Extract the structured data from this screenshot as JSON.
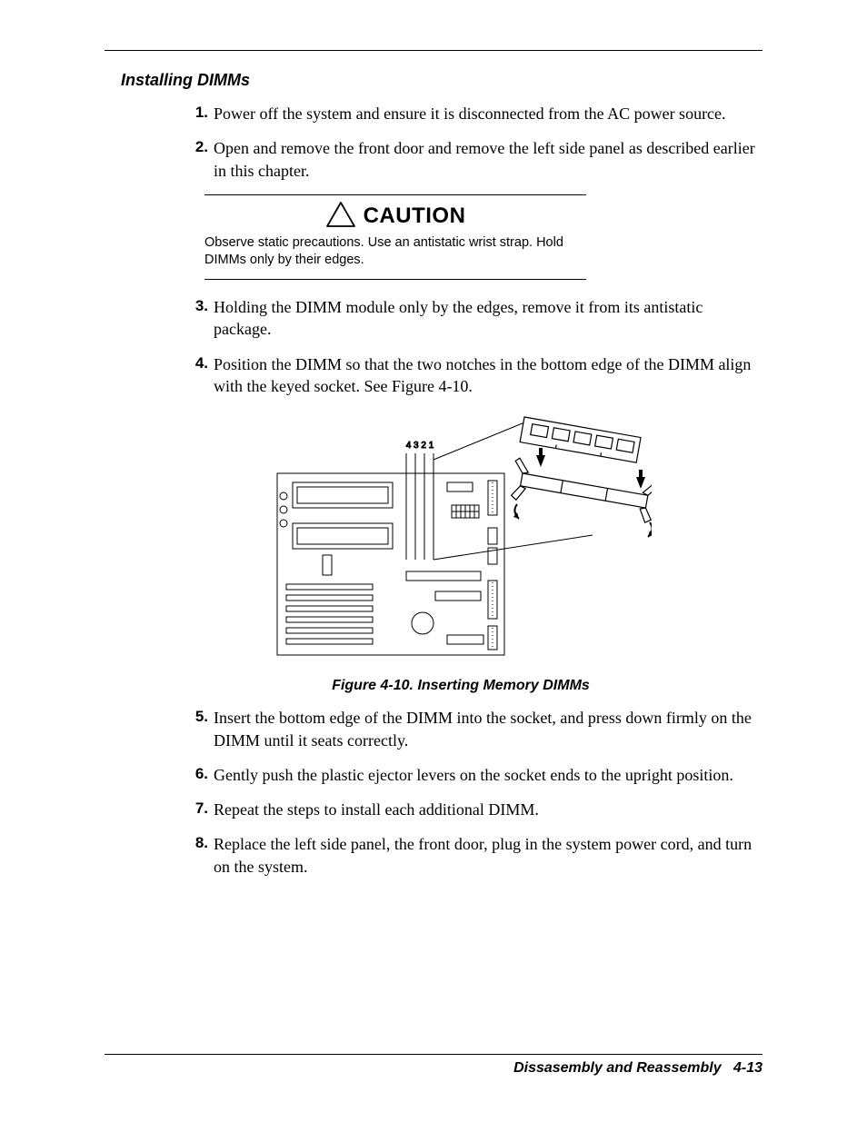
{
  "section_title": "Installing DIMMs",
  "steps": [
    "Power off the system and ensure it is disconnected from the AC power source.",
    "Open and remove the front door and remove the left side panel as described earlier in this chapter.",
    "Holding the DIMM module only by the edges, remove it from its antistatic package.",
    "Position the DIMM so that the two notches in the bottom edge of the DIMM align with the keyed socket. See Figure 4-10.",
    "Insert the bottom edge of the DIMM into the socket, and press down firmly on the DIMM until it seats correctly.",
    "Gently push the plastic ejector levers on the socket ends to the upright position.",
    "Repeat the steps to install each additional DIMM.",
    "Replace the left side panel, the front door, plug in the system power cord, and turn on the system."
  ],
  "caution": {
    "label": "CAUTION",
    "text": "Observe static precautions. Use an antistatic wrist strap. Hold DIMMs only by their edges."
  },
  "figure": {
    "caption": "Figure 4-10. Inserting Memory DIMMs",
    "slot_labels": "4 3 2 1"
  },
  "footer": {
    "section": "Dissasembly and Reassembly",
    "page": "4-13"
  }
}
